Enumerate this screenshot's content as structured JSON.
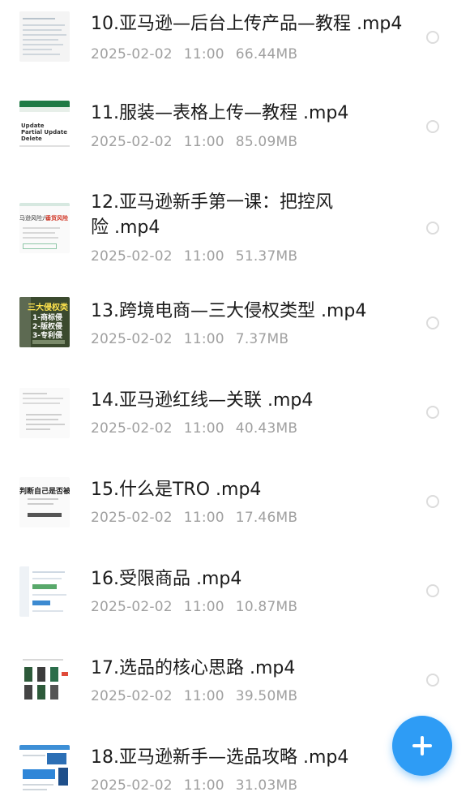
{
  "files": [
    {
      "name": "10.亚马逊—后台上传产品—教程 .mp4",
      "date": "2025-02-02",
      "time": "11:00",
      "size": "66.44MB",
      "thumb": "spreadsheet-doc"
    },
    {
      "name": "11.服装—表格上传—教程 .mp4",
      "date": "2025-02-02",
      "time": "11:00",
      "size": "85.09MB",
      "thumb": "excel-table",
      "thumb_text": [
        "Update",
        "Partial Update",
        "Delete"
      ]
    },
    {
      "name_line1": "12.亚马逊新手第一课：把控风",
      "name_line2": "险 .mp4",
      "date": "2025-02-02",
      "time": "11:00",
      "size": "51.37MB",
      "thumb": "slide-risk",
      "thumb_text": [
        "马逊风险六：",
        "垂货风险"
      ]
    },
    {
      "name": "13.跨境电商—三大侵权类型 .mp4",
      "date": "2025-02-02",
      "time": "11:00",
      "size": "7.37MB",
      "thumb": "infringement-poster",
      "thumb_text": [
        "三大侵权类",
        "1-商标侵",
        "2-版权侵",
        "3-专利侵"
      ]
    },
    {
      "name": "14.亚马逊红线—关联 .mp4",
      "date": "2025-02-02",
      "time": "11:00",
      "size": "40.43MB",
      "thumb": "text-doc"
    },
    {
      "name": "15.什么是TRO .mp4",
      "date": "2025-02-02",
      "time": "11:00",
      "size": "17.46MB",
      "thumb": "slide-tro",
      "thumb_text": [
        "判断自己是否被TR"
      ]
    },
    {
      "name": "16.受限商品 .mp4",
      "date": "2025-02-02",
      "time": "11:00",
      "size": "10.87MB",
      "thumb": "web-page"
    },
    {
      "name": "17.选品的核心思路 .mp4",
      "date": "2025-02-02",
      "time": "11:00",
      "size": "39.50MB",
      "thumb": "product-grid"
    },
    {
      "name": "18.亚马逊新手—选品攻略 .mp4",
      "date": "2025-02-02",
      "time": "11:00",
      "size": "31.03MB",
      "thumb": "blue-banner"
    }
  ],
  "fab": {
    "icon": "plus-icon"
  },
  "colors": {
    "accent": "#2e9cf5",
    "meta_text": "#a0a0a0",
    "title_text": "#1b1b1b"
  }
}
